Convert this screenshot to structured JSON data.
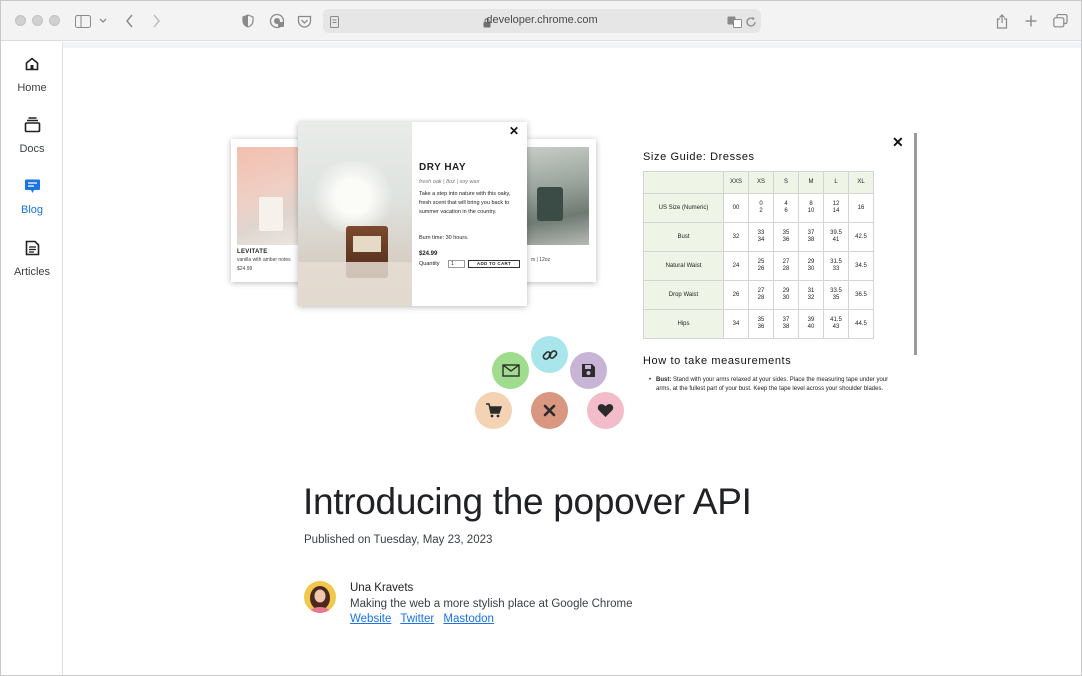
{
  "browser": {
    "url": "developer.chrome.com",
    "icons": [
      "sidebar-icon",
      "chevron-down-icon",
      "back-icon",
      "forward-icon",
      "shield-icon",
      "password-icon",
      "pocket-icon",
      "page-icon",
      "lock-icon",
      "translate-icon",
      "reload-icon",
      "share-icon",
      "new-tab-icon",
      "tabs-overview-icon"
    ]
  },
  "sidebar": {
    "items": [
      {
        "label": "Home",
        "icon": "home-icon"
      },
      {
        "label": "Docs",
        "icon": "docs-icon"
      },
      {
        "label": "Blog",
        "icon": "blog-icon",
        "active": true
      },
      {
        "label": "Articles",
        "icon": "articles-icon"
      }
    ]
  },
  "hero": {
    "cards": {
      "left": {
        "name": "LEVITATE",
        "desc": "vanilla with amber notes",
        "price": "$24.99"
      },
      "center": {
        "name": "DRY HAY",
        "subtitle": "fresh oak | 8oz | soy wax",
        "desc": "Take a step into nature with this oaky, fresh scent that will bring you back to summer vacation in the country.",
        "burn": "Burn time: 30 hours.",
        "price": "$24.99",
        "qty_label": "Quantity",
        "qty_value": "1",
        "add_to_cart": "ADD TO CART",
        "close": "✕"
      },
      "right": {
        "desc": "m | 12oz"
      }
    },
    "size_guide": {
      "title": "Size Guide: Dresses",
      "close": "✕",
      "headers": [
        "",
        "XXS",
        "XS",
        "S",
        "M",
        "L",
        "XL"
      ],
      "rows": [
        {
          "label": "US Size (Numeric)",
          "cells": [
            "00",
            "0\n2",
            "4\n6",
            "8\n10",
            "12\n14",
            "16"
          ]
        },
        {
          "label": "Bust",
          "cells": [
            "32",
            "33\n34",
            "35\n36",
            "37\n38",
            "39.5\n41",
            "42.5"
          ]
        },
        {
          "label": "Natural Waist",
          "cells": [
            "24",
            "25\n26",
            "27\n28",
            "29\n30",
            "31.5\n33",
            "34.5"
          ]
        },
        {
          "label": "Drop Waist",
          "cells": [
            "26",
            "27\n28",
            "29\n30",
            "31\n32",
            "33.5\n35",
            "36.5"
          ]
        },
        {
          "label": "Hips",
          "cells": [
            "34",
            "35\n36",
            "37\n38",
            "39\n40",
            "41.5\n43",
            "44.5"
          ]
        }
      ],
      "measure_title": "How to take measurements",
      "measure_label": "Bust:",
      "measure_text": "Stand with your arms relaxed at your sides. Place the measuring tape under your arms, at the fullest part of your bust. Keep the tape level across your shoulder blades."
    },
    "bubbles": [
      {
        "icon": "mail-icon",
        "color": "#9fdc8e"
      },
      {
        "icon": "link-icon",
        "color": "#a8e6ec"
      },
      {
        "icon": "save-icon",
        "color": "#c8b5d6"
      },
      {
        "icon": "cart-icon",
        "color": "#f4d3b5"
      },
      {
        "icon": "close-icon",
        "color": "#d99680"
      },
      {
        "icon": "heart-icon",
        "color": "#f3bccb"
      }
    ]
  },
  "article": {
    "title": "Introducing the popover API",
    "published": "Published on Tuesday, May 23, 2023",
    "author": {
      "name": "Una Kravets",
      "bio": "Making the web a more stylish place at Google Chrome",
      "links": [
        "Website",
        "Twitter",
        "Mastodon"
      ]
    }
  }
}
